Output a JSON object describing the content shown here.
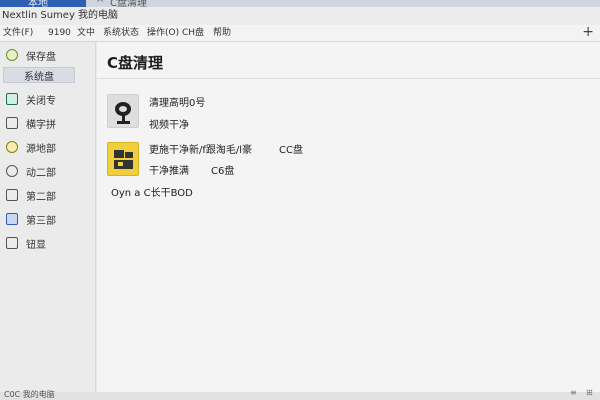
{
  "window": {
    "top_tab_left": "本地",
    "top_tab_right": "C盘清理",
    "title": "Nextlin Sumey 我的电脑"
  },
  "menu": {
    "items": [
      "文件(F)",
      "9190",
      "文中",
      "系统状态",
      "操作(O)",
      "CH盘",
      "帮助"
    ],
    "plus": "+"
  },
  "sidebar": {
    "items": [
      {
        "label": "保存盘",
        "icon": "disk-circle-icon"
      },
      {
        "label": "系统盘",
        "icon": "none",
        "selected": true
      },
      {
        "label": "关闭专",
        "icon": "doc-icon"
      },
      {
        "label": "横字拼",
        "icon": "page-icon"
      },
      {
        "label": "源地部",
        "icon": "circle-icon"
      },
      {
        "label": "动二部",
        "icon": "circle-icon"
      },
      {
        "label": "第二部",
        "icon": "page-icon"
      },
      {
        "label": "第三部",
        "icon": "square-icon"
      },
      {
        "label": "钮显",
        "icon": "bracket-icon"
      }
    ]
  },
  "main": {
    "title": "C盘清理",
    "entries": [
      {
        "name": "清理高明0号",
        "desc": "视频干净",
        "extra": ""
      },
      {
        "name": "更施干净新/f跟淘毛/l豪",
        "desc": "干净推满",
        "tag": "CC盘",
        "tag2": "C6盘"
      }
    ],
    "footer_line": "Oyn a   C长干BOD"
  },
  "status": {
    "text": "C0C 我的电脑",
    "indicator1": "≡",
    "indicator2": "⊞"
  }
}
